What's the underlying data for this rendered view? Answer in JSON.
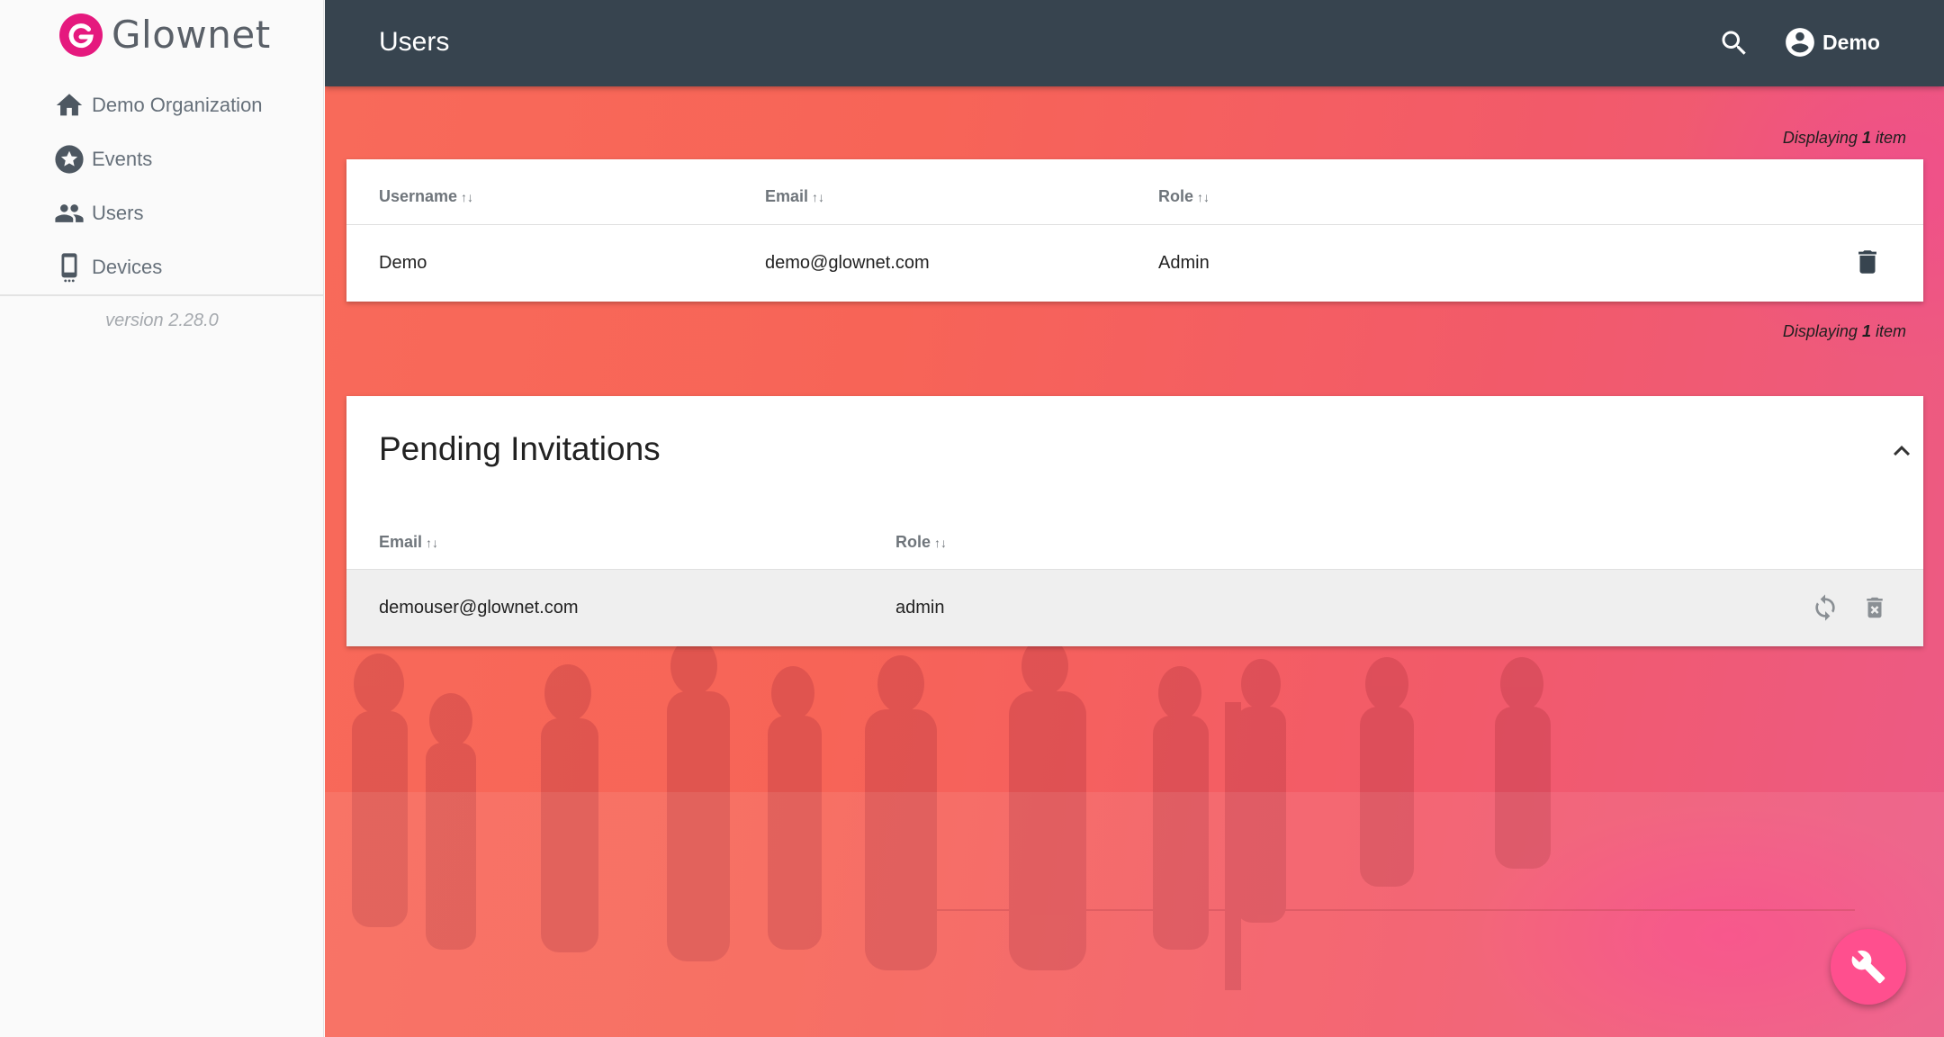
{
  "app": {
    "brand": "Glownet",
    "version": "version 2.28.0"
  },
  "sidebar": {
    "items": [
      {
        "label": "Demo Organization",
        "icon": "home-icon"
      },
      {
        "label": "Events",
        "icon": "star-icon"
      },
      {
        "label": "Users",
        "icon": "people-icon"
      },
      {
        "label": "Devices",
        "icon": "phone-icon"
      }
    ]
  },
  "header": {
    "title": "Users",
    "user": "Demo"
  },
  "users": {
    "display_prefix": "Displaying",
    "display_count": "1",
    "display_suffix": "item",
    "columns": [
      "Username",
      "Email",
      "Role"
    ],
    "rows": [
      {
        "username": "Demo",
        "email": "demo@glownet.com",
        "role": "Admin"
      }
    ]
  },
  "pending": {
    "title": "Pending Invitations",
    "columns": [
      "Email",
      "Role"
    ],
    "rows": [
      {
        "email": "demouser@glownet.com",
        "role": "admin"
      }
    ]
  },
  "sort_glyph": "↑↓",
  "colors": {
    "accent": "#e5197e",
    "topbar": "#37444f",
    "fab": "#ff4f8e"
  }
}
